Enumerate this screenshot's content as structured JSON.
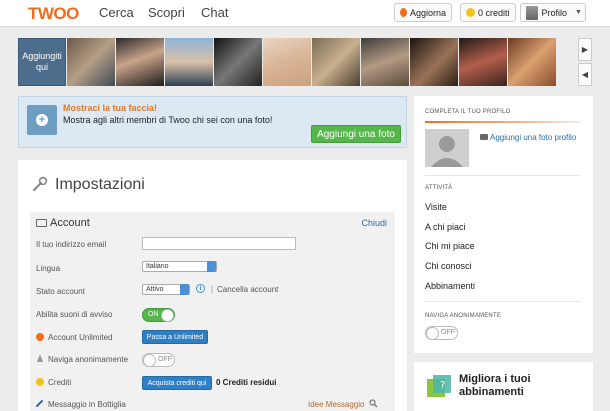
{
  "topbar": {
    "logo": "TWOO",
    "nav": [
      "Cerca",
      "Scopri",
      "Chat"
    ],
    "refresh_label": "Aggiorna",
    "credits_label": "0 crediti",
    "profile_label": "Profilo"
  },
  "strip": {
    "add_me_label": "Aggiungiti qui"
  },
  "promo": {
    "title": "Mostraci la tua faccia!",
    "text": "Mostra agli altri membri di Twoo chi sei con una foto!",
    "button_label": "Aggiungi una foto"
  },
  "settings": {
    "title": "Impostazioni",
    "account": {
      "heading": "Account",
      "close_label": "Chiudi",
      "email_label": "Il tuo indirizzo email",
      "email_value": "",
      "language_label": "Lingua",
      "language_value": "Italiano",
      "status_label": "Stato account",
      "status_value": "Attivo",
      "cancel_account_label": "Cancella account",
      "sound_label": "Abilita suoni di avviso",
      "sound_toggle": "ON",
      "unlimited_label": "Account Unlimited",
      "unlimited_button": "Passa a Unlimited",
      "anon_label": "Naviga anonimamente",
      "anon_toggle": "OFF",
      "credits_label": "Crediti",
      "credits_button": "Acquista crediti qui",
      "credits_remaining": "0 Crediti residui",
      "bottle_label": "Messaggio in Bottiglia",
      "ideas_label": "Idee Messaggio"
    }
  },
  "sidebar": {
    "complete_head": "COMPLETA IL TUO PROFILO",
    "complete_link": "Aggiungi una foto profilo",
    "activity_head": "ATTIVITÀ",
    "activity_items": [
      "Visite",
      "A chi piaci",
      "Chi mi piace",
      "Chi conosci",
      "Abbinamenti"
    ],
    "anon_head": "NAVIGA ANONIMAMENTE",
    "anon_toggle": "OFF",
    "improve_title": "Migliora i tuoi abbinamenti"
  },
  "colors": {
    "brand_orange": "#f26c1e",
    "link_blue": "#2e6da4",
    "button_green": "#55b64a",
    "button_blue": "#2f7fc4"
  }
}
